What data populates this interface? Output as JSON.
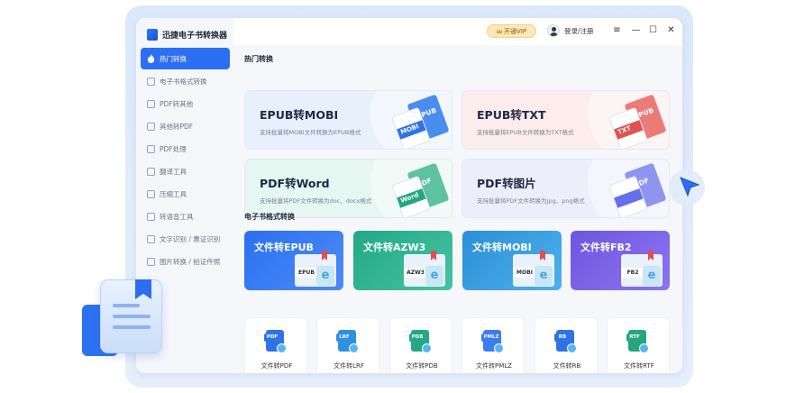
{
  "app": {
    "title": "迅捷电子书转换器"
  },
  "sidebar": {
    "items": [
      {
        "label": "热门转换",
        "icon": "fire-icon",
        "active": true
      },
      {
        "label": "电子书格式转换",
        "icon": "book-icon"
      },
      {
        "label": "PDF转其他",
        "icon": "pdf-export-icon"
      },
      {
        "label": "其他转PDF",
        "icon": "pdf-import-icon"
      },
      {
        "label": "PDF处理",
        "icon": "pdf-tool-icon"
      },
      {
        "label": "翻译工具",
        "icon": "translate-icon"
      },
      {
        "label": "压缩工具",
        "icon": "compress-icon"
      },
      {
        "label": "转语音工具",
        "icon": "audio-icon"
      },
      {
        "label": "文字识别 / 票证识别",
        "icon": "ocr-icon"
      },
      {
        "label": "图片转换 / 拍证件照",
        "icon": "image-icon"
      }
    ]
  },
  "topbar": {
    "vip_label": "开通VIP",
    "login_label": "登录/注册",
    "menu_icon": "≡",
    "minimize_icon": "—",
    "maximize_icon": "☐",
    "close_icon": "✕"
  },
  "main": {
    "hot_title": "热门转换",
    "hot_cards": [
      {
        "title": "EPUB转MOBI",
        "desc": "支持批量将MOBI文件转换为EPUB格式",
        "tag_front": "MOBI",
        "tag_back": "EPUB",
        "bg": "#e8f0fc",
        "front": "#2f74e6",
        "back": "#4a8df0"
      },
      {
        "title": "EPUB转TXT",
        "desc": "支持批量将EPUB文件转换为TXT格式",
        "tag_front": "TXT",
        "tag_back": "EPUB",
        "bg": "#fcecec",
        "front": "#e2524f",
        "back": "#ec7a78"
      },
      {
        "title": "PDF转Word",
        "desc": "支持批量将PDF文件转换为doc、docx格式",
        "tag_front": "Word",
        "tag_back": "PDF",
        "bg": "#e6f6f0",
        "front": "#25a67e",
        "back": "#5cc29f"
      },
      {
        "title": "PDF转图片",
        "desc": "支持批量将PDF文件转换为jpg、png格式",
        "tag_front": "",
        "tag_back": "PDF",
        "bg": "#edeefc",
        "front": "#6470e8",
        "back": "#8d95ef"
      }
    ],
    "format_title": "电子书格式转换",
    "format_cards": [
      {
        "title": "文件转EPUB",
        "tag": "EPUB",
        "from": "#2b6ff0",
        "to": "#4c8cf6"
      },
      {
        "title": "文件转AZW3",
        "tag": "AZW3",
        "from": "#22a885",
        "to": "#45c3a1"
      },
      {
        "title": "文件转MOBI",
        "tag": "MOBI",
        "from": "#2a8fd8",
        "to": "#4fb0ea"
      },
      {
        "title": "文件转FB2",
        "tag": "FB2",
        "from": "#6e55e0",
        "to": "#8c74ef"
      }
    ],
    "small_cards": [
      {
        "label": "文件转PDF",
        "tag": "PDF",
        "color": "#2f74e6"
      },
      {
        "label": "文件转LRF",
        "tag": "LRF",
        "color": "#2f8fe0"
      },
      {
        "label": "文件转PDB",
        "tag": "PDB",
        "color": "#22a885"
      },
      {
        "label": "文件转PMLZ",
        "tag": "PMLZ",
        "color": "#3b7cf0"
      },
      {
        "label": "文件转RB",
        "tag": "RB",
        "color": "#2f74e6"
      },
      {
        "label": "文件转RTF",
        "tag": "RTF",
        "color": "#25a67e"
      }
    ]
  }
}
